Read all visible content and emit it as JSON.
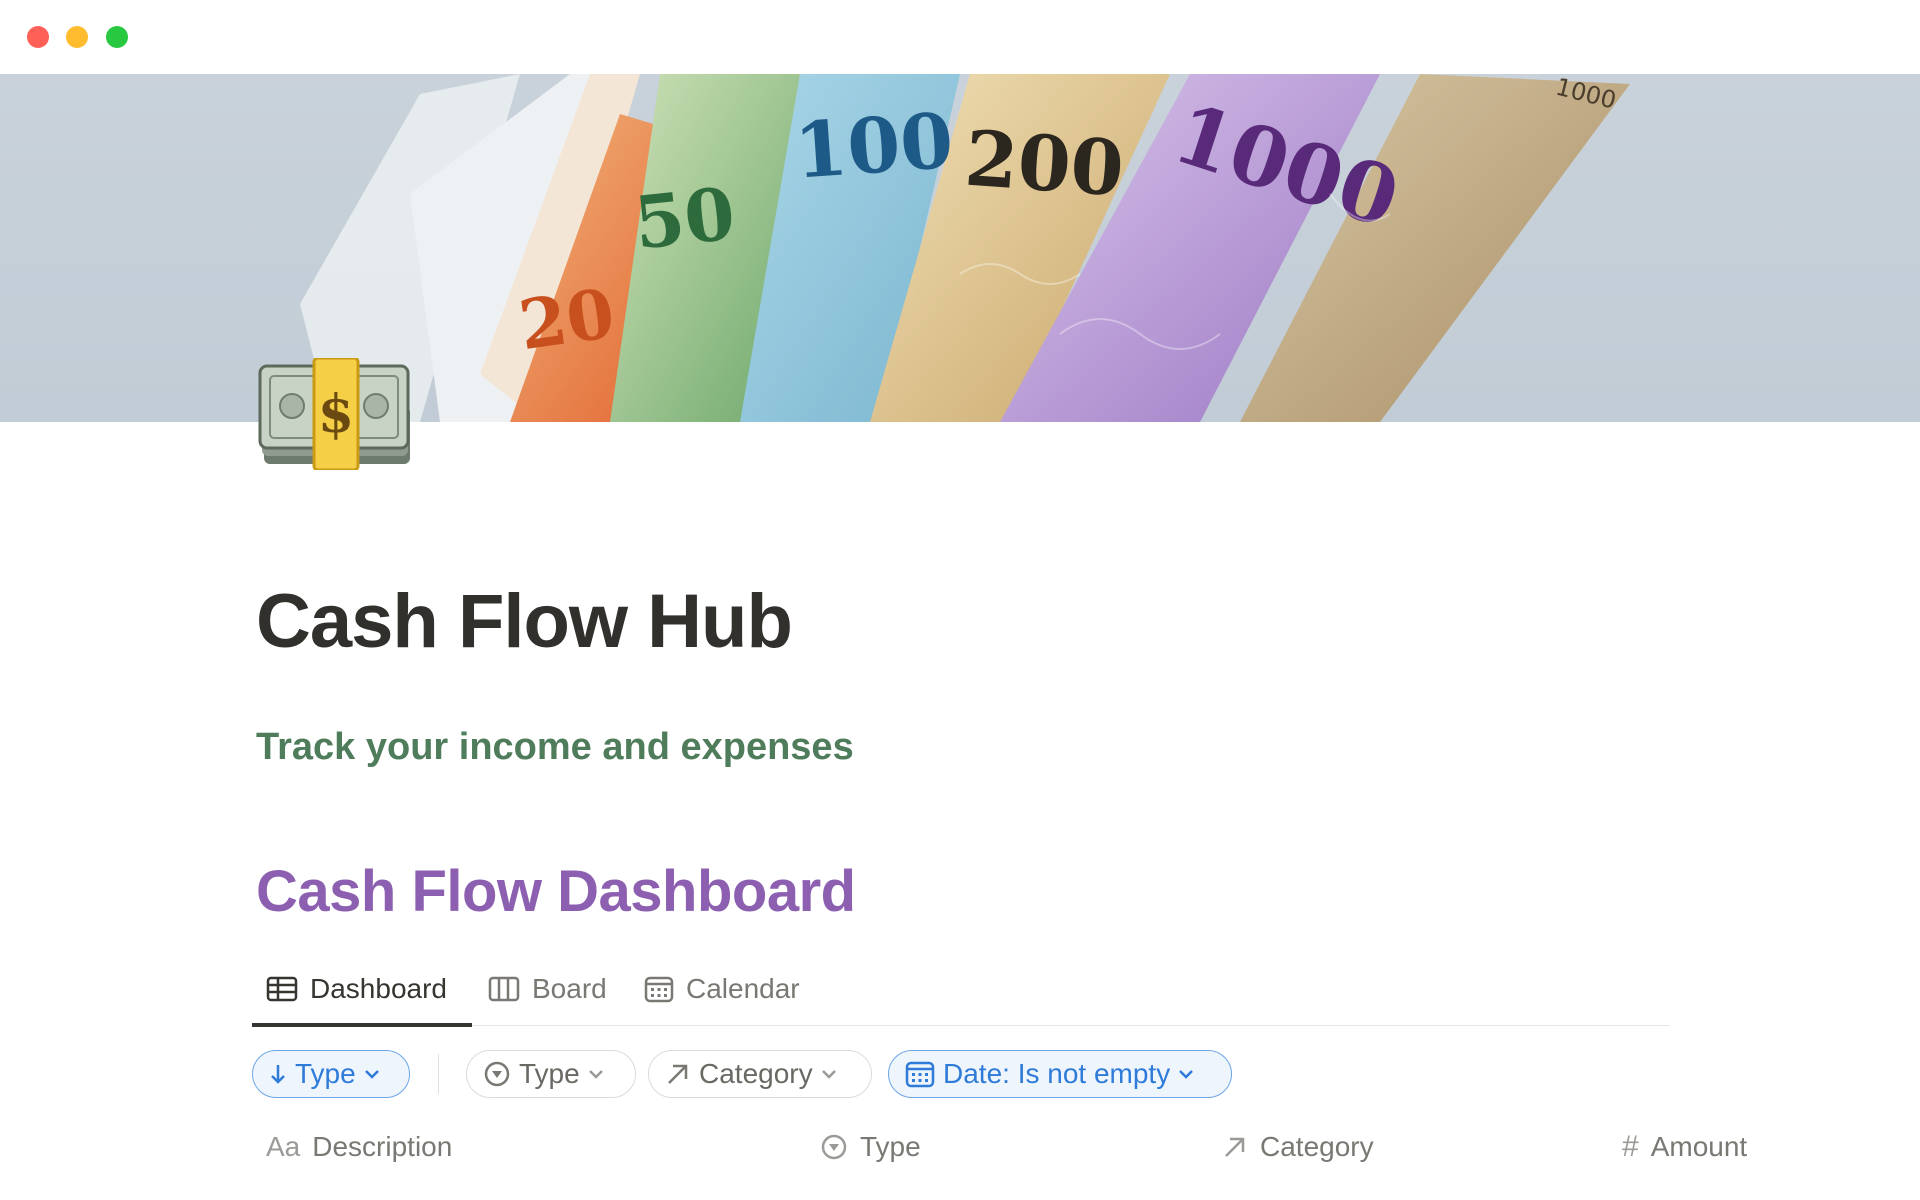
{
  "window": {
    "controls": [
      "close",
      "minimize",
      "maximize"
    ]
  },
  "cover": {
    "banknote_values": [
      "20",
      "50",
      "100",
      "200",
      "1000"
    ]
  },
  "page": {
    "icon": "money-banknote-icon",
    "title": "Cash Flow Hub",
    "subtitle": "Track your income and expenses"
  },
  "section": {
    "title": "Cash Flow Dashboard"
  },
  "tabs": [
    {
      "label": "Dashboard",
      "icon": "table-icon",
      "active": true
    },
    {
      "label": "Board",
      "icon": "board-icon",
      "active": false
    },
    {
      "label": "Calendar",
      "icon": "calendar-icon",
      "active": false
    }
  ],
  "filters": {
    "sort": {
      "label": "Type",
      "icon": "arrow-down-icon"
    },
    "chips": [
      {
        "label": "Type",
        "icon": "select-icon"
      },
      {
        "label": "Category",
        "icon": "relation-arrow-icon"
      },
      {
        "label": "Date: Is not empty",
        "icon": "calendar-icon"
      }
    ]
  },
  "table": {
    "columns": [
      {
        "label": "Description",
        "icon_text": "Aa"
      },
      {
        "label": "Type",
        "icon": "select-icon"
      },
      {
        "label": "Category",
        "icon": "relation-arrow-icon"
      },
      {
        "label": "Amount",
        "icon_text": "#"
      }
    ]
  },
  "colors": {
    "title": "#32302c",
    "subtitle": "#4f7d5c",
    "section_title": "#8c5fb1",
    "accent_blue": "#2f7bd9"
  }
}
